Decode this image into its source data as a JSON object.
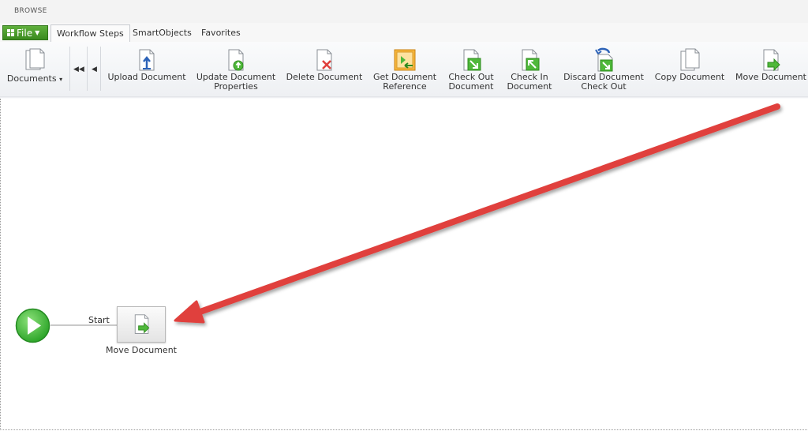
{
  "browse": {
    "label": "BROWSE"
  },
  "tabs": {
    "file_label": "File",
    "items": [
      {
        "label": "Workflow Steps",
        "active": true
      },
      {
        "label": "SmartObjects",
        "active": false
      },
      {
        "label": "Favorites",
        "active": false
      }
    ]
  },
  "ribbon": {
    "documents_label": "Documents",
    "documents_dropdown": "▾",
    "nav_first": "◀◀",
    "nav_prev": "◀",
    "buttons": [
      {
        "label": "Upload Document"
      },
      {
        "label_line1": "Update Document",
        "label_line2": "Properties"
      },
      {
        "label": "Delete Document"
      },
      {
        "label_line1": "Get Document",
        "label_line2": "Reference"
      },
      {
        "label_line1": "Check Out",
        "label_line2": "Document"
      },
      {
        "label_line1": "Check In",
        "label_line2": "Document"
      },
      {
        "label_line1": "Discard Document",
        "label_line2": "Check Out"
      },
      {
        "label": "Copy Document"
      },
      {
        "label": "Move Document"
      }
    ]
  },
  "canvas": {
    "connector_label": "Start",
    "step_label": "Move Document"
  },
  "colors": {
    "accent_green": "#3b8a1f",
    "arrow_red": "#e0403c",
    "start_green": "#4cc24a"
  }
}
